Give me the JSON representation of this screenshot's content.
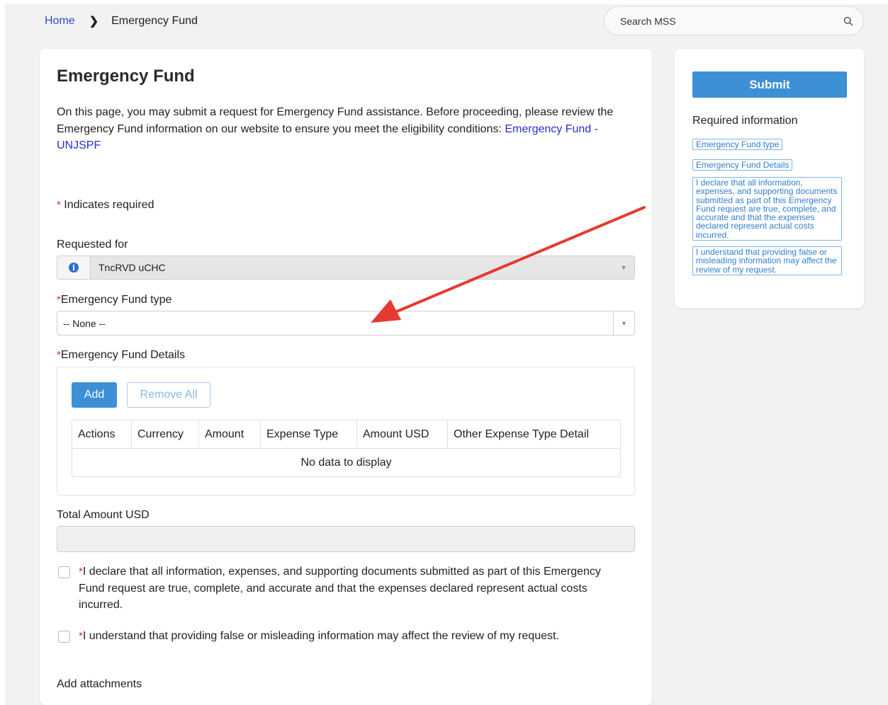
{
  "breadcrumb": {
    "home": "Home",
    "separator": "❯",
    "current": "Emergency Fund"
  },
  "search": {
    "placeholder": "Search MSS"
  },
  "form": {
    "title": "Emergency Fund",
    "intro_text": "On this page, you may submit a request for Emergency Fund assistance. Before proceeding, please review the Emergency Fund information on our website to ensure you meet the eligibility conditions: ",
    "intro_link": "Emergency Fund - UNJSPF",
    "required_star": "*",
    "required_note": "Indicates required",
    "requested_for_label": "Requested for",
    "requested_for_value": "TncRVD uCHC",
    "fund_type_label": "Emergency Fund type",
    "fund_type_value": "-- None --",
    "details_label": "Emergency Fund Details",
    "add_button": "Add",
    "remove_all_button": "Remove All",
    "table_columns": [
      "Actions",
      "Currency",
      "Amount",
      "Expense Type",
      "Amount USD",
      "Other Expense Type Detail"
    ],
    "empty_message": "No data to display",
    "total_label": "Total Amount USD",
    "total_value": "",
    "declare_text": "I declare that all information, expenses, and supporting documents submitted as part of this Emergency Fund request are true, complete, and accurate and that the expenses declared represent actual costs incurred.",
    "understand_text": "I understand that providing false or misleading information may affect the review of my request.",
    "attachments_label": "Add attachments"
  },
  "sidebar": {
    "submit_button": "Submit",
    "required_title": "Required information",
    "required_items": [
      "Emergency Fund type",
      "Emergency Fund Details",
      "I declare that all information, expenses, and supporting documents submitted as part of this Emergency Fund request are true, complete, and accurate and that the expenses declared represent actual costs incurred.",
      "I understand that providing false or misleading information may affect the review of my request."
    ]
  },
  "colors": {
    "primary_button": "#3d8fd6",
    "link": "#2a2fd0",
    "required_star": "#d32f2f",
    "annotation_arrow": "#e53a2f"
  },
  "icons": {
    "search": "search-icon",
    "info": "info-icon",
    "dropdown": "chevron-down-icon"
  }
}
